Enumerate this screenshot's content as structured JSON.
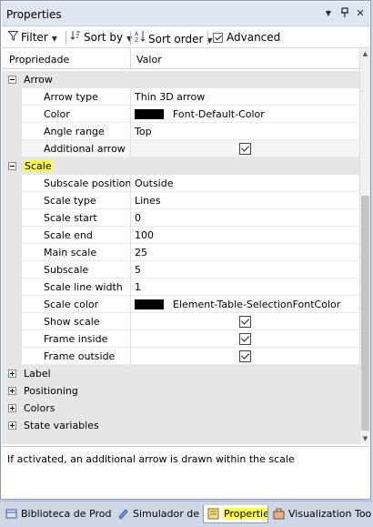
{
  "window": {
    "title": "Properties",
    "controls": {
      "dropdown": "▼",
      "pin": "📌",
      "close": "✕"
    }
  },
  "toolbar": {
    "filter_label": "Filter",
    "sort_by_label": "Sort by",
    "sort_order_label": "Sort order",
    "advanced_label": "Advanced",
    "advanced_checked": true
  },
  "grid": {
    "col_property": "Propriedade",
    "col_value": "Valor",
    "arrow": {
      "label": "Arrow",
      "arrow_type": {
        "label": "Arrow type",
        "value": "Thin 3D arrow"
      },
      "color": {
        "label": "Color",
        "value": "Font-Default-Color",
        "swatch": "#000000"
      },
      "angle_range": {
        "label": "Angle range",
        "value": "Top"
      },
      "additional_arrow": {
        "label": "Additional arrow",
        "checked": true
      }
    },
    "scale": {
      "label": "Scale",
      "subscale_position": {
        "label": "Subscale position",
        "value": "Outside"
      },
      "scale_type": {
        "label": "Scale type",
        "value": "Lines"
      },
      "scale_start": {
        "label": "Scale start",
        "value": "0"
      },
      "scale_end": {
        "label": "Scale end",
        "value": "100"
      },
      "main_scale": {
        "label": "Main scale",
        "value": "25"
      },
      "subscale": {
        "label": "Subscale",
        "value": "5"
      },
      "scale_line_width": {
        "label": "Scale line width",
        "value": "1"
      },
      "scale_color": {
        "label": "Scale color",
        "value": "Element-Table-SelectionFontColor",
        "swatch": "#000000"
      },
      "show_scale": {
        "label": "Show scale",
        "checked": true
      },
      "frame_inside": {
        "label": "Frame inside",
        "checked": true
      },
      "frame_outside": {
        "label": "Frame outside",
        "checked": true
      }
    },
    "collapsed": {
      "label": "Label",
      "positioning": "Positioning",
      "colors": "Colors",
      "state_variables": "State variables"
    }
  },
  "description": "If activated, an additional arrow is drawn within the scale",
  "tabs": {
    "library": "Biblioteca de Prod...",
    "simulator": "Simulador de ...",
    "properties": "Properties",
    "visualization": "Visualization Tool..."
  },
  "colors": {
    "highlight": "#ffff4d",
    "titlebar": "#dfe5f1",
    "category_bg": "#e6e6e6"
  }
}
